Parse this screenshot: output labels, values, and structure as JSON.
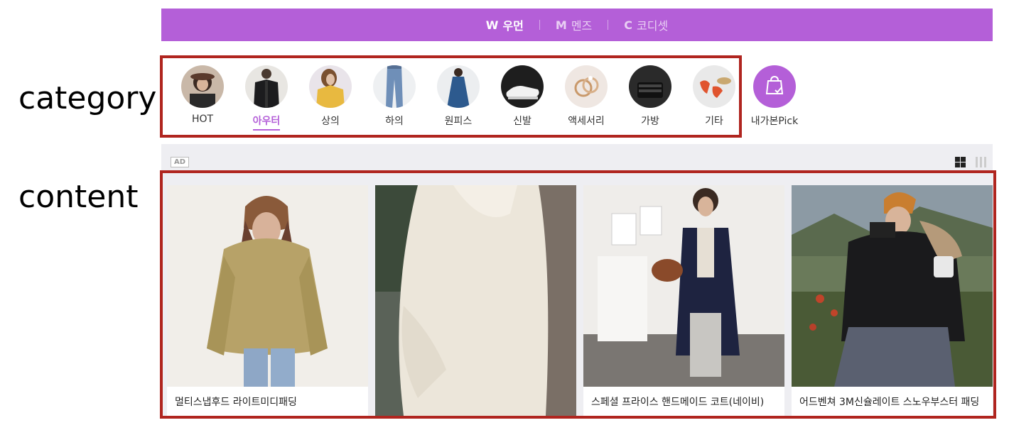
{
  "annotations": {
    "category": "category",
    "content": "content"
  },
  "nav": {
    "tabs": [
      {
        "letter": "W",
        "label": "우먼",
        "active": true
      },
      {
        "letter": "M",
        "label": "멘즈",
        "active": false
      },
      {
        "letter": "C",
        "label": "코디셋",
        "active": false
      }
    ]
  },
  "categories": {
    "items": [
      {
        "label": "HOT"
      },
      {
        "label": "아우터",
        "active": true
      },
      {
        "label": "상의"
      },
      {
        "label": "하의"
      },
      {
        "label": "원피스"
      },
      {
        "label": "신발"
      },
      {
        "label": "액세서리"
      },
      {
        "label": "가방"
      },
      {
        "label": "기타"
      }
    ],
    "pick_label": "내가본Pick"
  },
  "ad_badge": "AD",
  "products": [
    {
      "title": "멀티스냅후드 라이트미디패딩"
    },
    {
      "title": ""
    },
    {
      "title": "스페셜 프라이스 핸드메이드 코트(네이비)"
    },
    {
      "title": "어드벤쳐 3M신슐레이트 스노우부스터 패딩"
    }
  ],
  "colors": {
    "accent": "#b45fd8",
    "annotation_box": "#b0251f"
  }
}
